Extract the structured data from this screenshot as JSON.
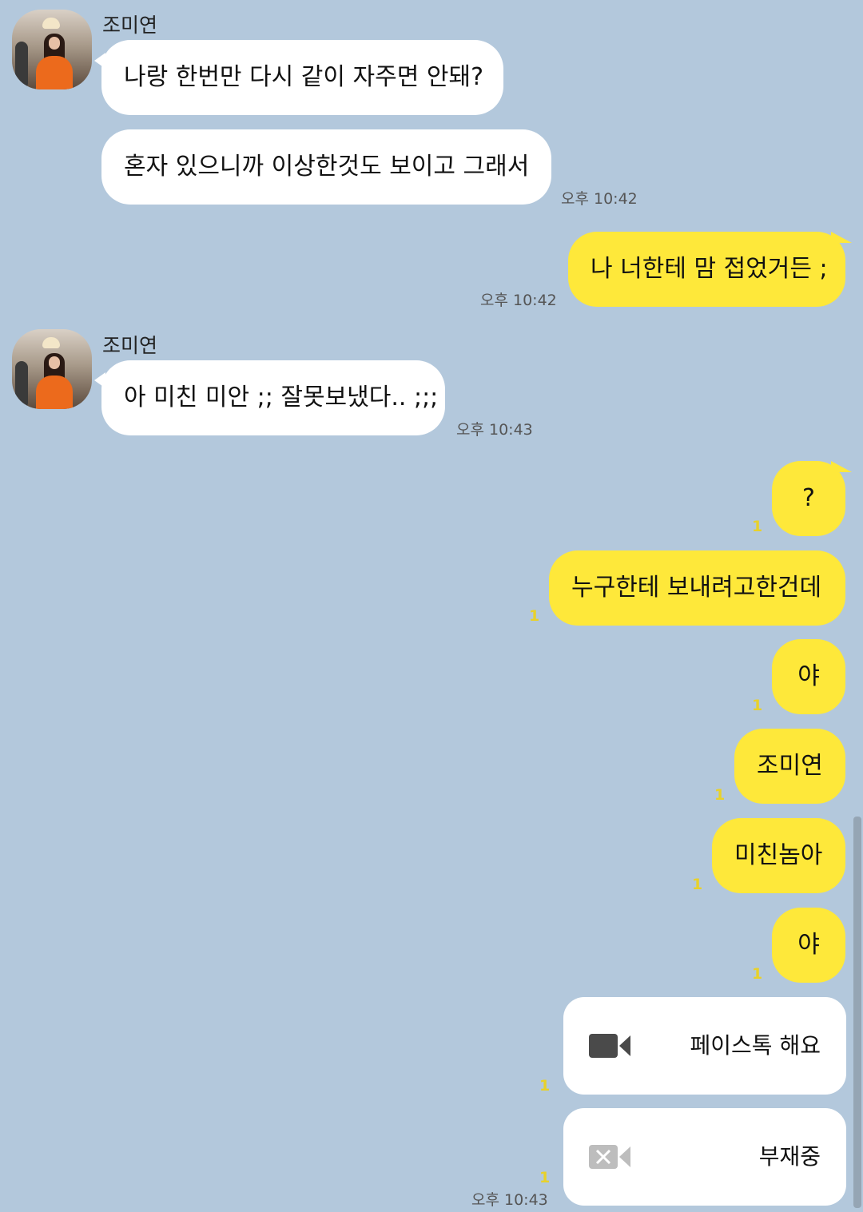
{
  "contact": {
    "name": "조미연"
  },
  "messages": {
    "m1": {
      "text": "나랑 한번만 다시 같이 자주면 안돼?"
    },
    "m2": {
      "text": "혼자 있으니까 이상한것도 보이고 그래서",
      "time": "오후 10:42"
    },
    "m3": {
      "text": "나 너한테 맘 접었거든 ;",
      "time": "오후 10:42"
    },
    "m4": {
      "text": "아 미친 미안 ;; 잘못보냈다.. ;;;",
      "time": "오후 10:43"
    },
    "m5": {
      "text": "?",
      "unread": "1"
    },
    "m6": {
      "text": "누구한테 보내려고한건데",
      "unread": "1"
    },
    "m7": {
      "text": "야",
      "unread": "1"
    },
    "m8": {
      "text": "조미연",
      "unread": "1"
    },
    "m9": {
      "text": "미친놈아",
      "unread": "1"
    },
    "m10": {
      "text": "야",
      "unread": "1"
    },
    "call1": {
      "label": "페이스톡 해요",
      "unread": "1",
      "icon": "video-camera-icon"
    },
    "call2": {
      "label": "부재중",
      "unread": "1",
      "time": "오후 10:43",
      "icon": "video-camera-missed-icon"
    }
  },
  "colors": {
    "background": "#b3c8dc",
    "my_bubble": "#fee83a",
    "their_bubble": "#ffffff",
    "unread_count": "#e8d12a"
  }
}
